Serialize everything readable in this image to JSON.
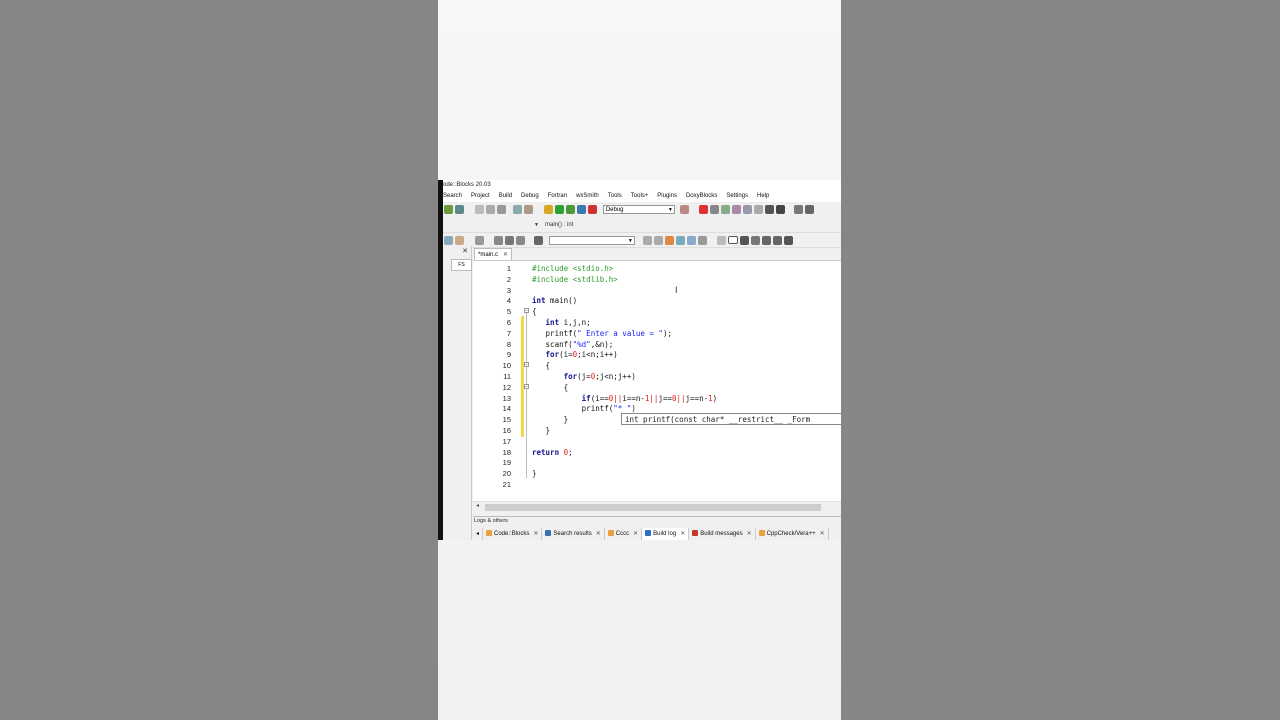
{
  "window": {
    "title": "ode::Blocks 20.03"
  },
  "menu": [
    "Search",
    "Project",
    "Build",
    "Debug",
    "Fortran",
    "wxSmith",
    "Tools",
    "Tools+",
    "Plugins",
    "DoxyBlocks",
    "Settings",
    "Help"
  ],
  "toolbar": {
    "build_target": "Debug",
    "scope_combo": "",
    "function_label": "main() : int"
  },
  "management": {
    "tab_label": "FS",
    "close": "✕"
  },
  "editor": {
    "tab_label": "*main.c",
    "tab_close": "✕",
    "lines": [
      {
        "n": "1",
        "tokens": [
          {
            "t": "#include <stdio.h>",
            "c": "pp"
          }
        ]
      },
      {
        "n": "2",
        "tokens": [
          {
            "t": "#include <stdlib.h>",
            "c": "pp"
          }
        ]
      },
      {
        "n": "3",
        "tokens": []
      },
      {
        "n": "4",
        "tokens": [
          {
            "t": "int",
            "c": "kw"
          },
          {
            "t": " main()",
            "c": ""
          }
        ]
      },
      {
        "n": "5",
        "tokens": [
          {
            "t": "{",
            "c": ""
          }
        ]
      },
      {
        "n": "6",
        "tokens": [
          {
            "t": "   ",
            "c": ""
          },
          {
            "t": "int",
            "c": "kw"
          },
          {
            "t": " i,j,n;",
            "c": ""
          }
        ]
      },
      {
        "n": "7",
        "tokens": [
          {
            "t": "   printf(",
            "c": ""
          },
          {
            "t": "\" Enter a value = \"",
            "c": "st"
          },
          {
            "t": ");",
            "c": ""
          }
        ]
      },
      {
        "n": "8",
        "tokens": [
          {
            "t": "   scanf(",
            "c": ""
          },
          {
            "t": "\"%d\"",
            "c": "st"
          },
          {
            "t": ",&n);",
            "c": ""
          }
        ]
      },
      {
        "n": "9",
        "tokens": [
          {
            "t": "   ",
            "c": ""
          },
          {
            "t": "for",
            "c": "kw"
          },
          {
            "t": "(i=",
            "c": ""
          },
          {
            "t": "0",
            "c": "num"
          },
          {
            "t": ";i<n;i++)",
            "c": ""
          }
        ]
      },
      {
        "n": "10",
        "tokens": [
          {
            "t": "   {",
            "c": ""
          }
        ]
      },
      {
        "n": "11",
        "tokens": [
          {
            "t": "       ",
            "c": ""
          },
          {
            "t": "for",
            "c": "kw"
          },
          {
            "t": "(j=",
            "c": ""
          },
          {
            "t": "0",
            "c": "num"
          },
          {
            "t": ";j<n;j++)",
            "c": ""
          }
        ]
      },
      {
        "n": "12",
        "tokens": [
          {
            "t": "       {",
            "c": ""
          }
        ]
      },
      {
        "n": "13",
        "tokens": [
          {
            "t": "           ",
            "c": ""
          },
          {
            "t": "if",
            "c": "kw"
          },
          {
            "t": "(i==",
            "c": ""
          },
          {
            "t": "0",
            "c": "num"
          },
          {
            "t": "||",
            "c": "op"
          },
          {
            "t": "i==n-",
            "c": ""
          },
          {
            "t": "1",
            "c": "num"
          },
          {
            "t": "||",
            "c": "op"
          },
          {
            "t": "j==",
            "c": ""
          },
          {
            "t": "0",
            "c": "num"
          },
          {
            "t": "||",
            "c": "op"
          },
          {
            "t": "j==n-",
            "c": ""
          },
          {
            "t": "1",
            "c": "num"
          },
          {
            "t": ")",
            "c": ""
          }
        ]
      },
      {
        "n": "14",
        "tokens": [
          {
            "t": "           printf(",
            "c": ""
          },
          {
            "t": "\"* \"",
            "c": "st"
          },
          {
            "t": ")",
            "c": ""
          }
        ]
      },
      {
        "n": "15",
        "tokens": [
          {
            "t": "       }",
            "c": ""
          }
        ]
      },
      {
        "n": "16",
        "tokens": [
          {
            "t": "   }",
            "c": ""
          }
        ]
      },
      {
        "n": "17",
        "tokens": []
      },
      {
        "n": "18",
        "tokens": [
          {
            "t": "return",
            "c": "kw"
          },
          {
            "t": " ",
            "c": ""
          },
          {
            "t": "0",
            "c": "num"
          },
          {
            "t": ";",
            "c": ""
          }
        ]
      },
      {
        "n": "19",
        "tokens": []
      },
      {
        "n": "20",
        "tokens": [
          {
            "t": "}",
            "c": ""
          }
        ]
      },
      {
        "n": "21",
        "tokens": []
      }
    ],
    "calltip": "int printf(const char* __restrict__ _Form"
  },
  "logs": {
    "title": "Logs & others",
    "tabs": [
      {
        "label": "Code::Blocks",
        "icon": "document-icon",
        "active": false
      },
      {
        "label": "Search results",
        "icon": "search-icon",
        "active": false
      },
      {
        "label": "Cccc",
        "icon": "document-icon",
        "active": false
      },
      {
        "label": "Build log",
        "icon": "gear-icon",
        "active": true
      },
      {
        "label": "Build messages",
        "icon": "diamond-icon",
        "active": false
      },
      {
        "label": "CppCheck/Vera++",
        "icon": "document-icon",
        "active": false
      }
    ]
  },
  "colors": {
    "preprocessor": "#2e9d2e",
    "keyword": "#10108a",
    "string": "#1a1aff",
    "number": "#e0201a",
    "change_marker": "#f1d94b"
  }
}
